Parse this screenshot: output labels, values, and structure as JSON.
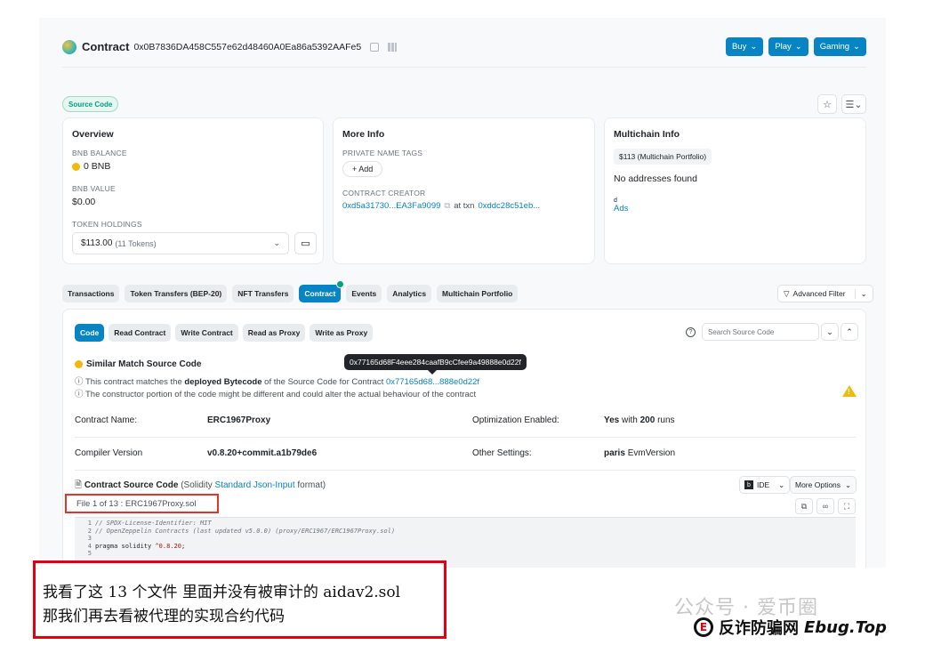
{
  "header": {
    "title": "Contract",
    "address": "0x0B7836DA458C557e62d48460A0Ea86a5392AAFe5",
    "buttons": [
      "Buy",
      "Play",
      "Gaming"
    ]
  },
  "badge": "Source Code",
  "overview": {
    "title": "Overview",
    "bnb_balance_label": "BNB BALANCE",
    "bnb_balance": "0 BNB",
    "bnb_value_label": "BNB VALUE",
    "bnb_value": "$0.00",
    "token_holdings_label": "TOKEN HOLDINGS",
    "token_holdings": "$113.00",
    "token_count": "(11 Tokens)"
  },
  "more_info": {
    "title": "More Info",
    "private_tags_label": "PRIVATE NAME TAGS",
    "add_label": "+ Add",
    "creator_label": "CONTRACT CREATOR",
    "creator": "0xd5a31730...EA3Fa9099",
    "at_txn": "at txn",
    "txn": "0xddc28c51eb..."
  },
  "multichain": {
    "title": "Multichain Info",
    "portfolio": "$113 (Multichain Portfolio)",
    "no_addresses": "No addresses found",
    "ads": "Ads",
    "ads_prefix": "d"
  },
  "tabs": [
    "Transactions",
    "Token Transfers (BEP-20)",
    "NFT Transfers",
    "Contract",
    "Events",
    "Analytics",
    "Multichain Portfolio"
  ],
  "advanced_filter": "Advanced Filter",
  "sub_tabs": [
    "Code",
    "Read Contract",
    "Write Contract",
    "Read as Proxy",
    "Write as Proxy"
  ],
  "search_placeholder": "Search Source Code",
  "tooltip": "0x77165d68F4eee284caafB9cCfee9a49888e0d22f",
  "similar_match": {
    "title": "Similar Match Source Code",
    "line1_pre": "This contract matches the",
    "line1_bold": "deployed Bytecode",
    "line1_mid": "of the Source Code for Contract",
    "line1_link": "0x77165d68...888e0d22f",
    "line2": "The constructor portion of the code might be different and could alter the actual behaviour of the contract"
  },
  "details": {
    "contract_name_label": "Contract Name:",
    "contract_name": "ERC1967Proxy",
    "optimization_label": "Optimization Enabled:",
    "optimization_yes": "Yes",
    "optimization_with": "with",
    "optimization_runs": "200",
    "optimization_runs_label": "runs",
    "compiler_label": "Compiler Version",
    "compiler": "v0.8.20+commit.a1b79de6",
    "other_label": "Other Settings:",
    "other_bold": "paris",
    "other_rest": "EvmVersion"
  },
  "source": {
    "title": "Contract Source Code",
    "paren_pre": "(Solidity",
    "link": "Standard Json-Input",
    "paren_post": "format)",
    "ide": "IDE",
    "more_options": "More Options",
    "file": "File 1 of 13 : ERC1967Proxy.sol"
  },
  "code_lines": [
    {
      "n": "1",
      "t": "// SPDX-License-Identifier: MIT",
      "kind": "comment"
    },
    {
      "n": "2",
      "t": "// OpenZeppelin Contracts (last updated v5.0.0) (proxy/ERC1967/ERC1967Proxy.sol)",
      "kind": "comment"
    },
    {
      "n": "3",
      "t": "",
      "kind": "plain"
    },
    {
      "n": "4",
      "t": "pragma solidity ^0.8.20;",
      "kind": "plain"
    },
    {
      "n": "5",
      "t": "",
      "kind": "plain"
    }
  ],
  "annotation": {
    "line1": "我看了这 13 个文件  里面并没有被审计的 aidav2.sol",
    "line2": "那我们再去看被代理的实现合约代码"
  },
  "watermark": {
    "line1": "公众号 · 爱币圈",
    "brand_cn": "反诈防骗网",
    "brand_en": "Ebug.Top"
  }
}
